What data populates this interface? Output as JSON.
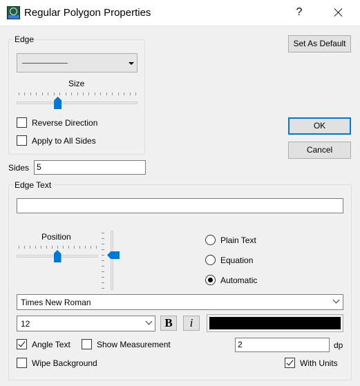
{
  "window": {
    "title": "Regular Polygon Properties",
    "help_glyph": "?",
    "close_icon": "close-icon",
    "app_icon": "pxo-app-icon"
  },
  "edge_group": {
    "label": "Edge",
    "line_style": "solid-line",
    "size_label": "Size",
    "size_fraction": 0.33,
    "reverse_direction": {
      "label": "Reverse Direction",
      "checked": false
    },
    "apply_all_sides": {
      "label": "Apply to All Sides",
      "checked": false
    }
  },
  "buttons": {
    "set_default": "Set As Default",
    "ok": "OK",
    "cancel": "Cancel"
  },
  "sides": {
    "label": "Sides",
    "value": "5"
  },
  "edge_text_group": {
    "label": "Edge Text",
    "text_value": "",
    "position_label": "Position",
    "horizontal_fraction": 0.5,
    "vertical_fraction": 0.4,
    "modes": [
      {
        "label": "Plain Text",
        "checked": false
      },
      {
        "label": "Equation",
        "checked": false
      },
      {
        "label": "Automatic",
        "checked": true
      }
    ],
    "font_family": "Times New Roman",
    "font_size": "12",
    "bold_label": "B",
    "italic_label": "i",
    "text_color": "#000000"
  },
  "options": {
    "angle_text": {
      "label": "Angle Text",
      "checked": true
    },
    "show_measurement": {
      "label": "Show Measurement",
      "checked": false
    },
    "wipe_background": {
      "label": "Wipe Background",
      "checked": false
    },
    "with_units": {
      "label": "With Units",
      "checked": true
    },
    "decimal_places": "2",
    "dp_label": "dp"
  },
  "colors": {
    "accent": "#0078d7",
    "dialog_bg": "#f0f0f0"
  }
}
